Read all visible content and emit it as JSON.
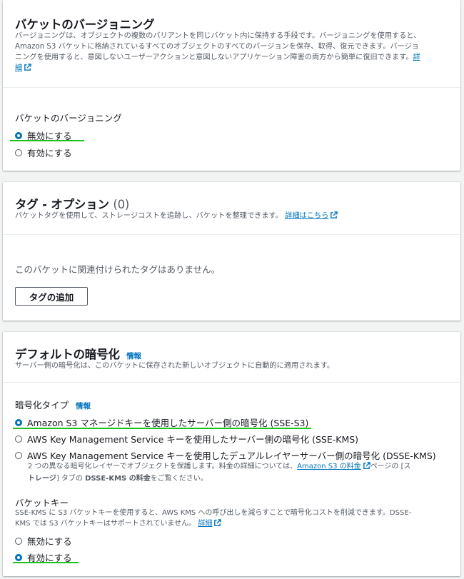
{
  "versioning": {
    "title": "バケットのバージョニング",
    "desc_line1": "バージョニングは、オブジェクトの複数のバリアントを同じバケット内に保持する手段です。バージョニングを使用すると、",
    "desc_line2": "Amazon S3 バケットに格納されているすべてのオブジェクトのすべてのバージョンを保存、取得、復元できます。バージョ",
    "desc_line3": "ニングを使用すると、意図しないユーザーアクションと意図しないアプリケーション障害の両方から簡単に復旧できます。",
    "desc_link_part1": "詳",
    "desc_link_part2": "細",
    "field_label": "バケットのバージョニング",
    "options": [
      "無効にする",
      "有効にする"
    ],
    "selected": "無効にする"
  },
  "tags": {
    "title": "タグ - オプション",
    "count": "(0)",
    "desc": "バケットタグを使用して、ストレージコストを追跡し、バケットを整理できます。",
    "desc_link": "詳細はこちら",
    "empty_text": "このバケットに関連付けられたタグはありません。",
    "add_button": "タグの追加"
  },
  "encryption": {
    "title": "デフォルトの暗号化",
    "info": "情報",
    "desc": "サーバー側の暗号化は、このバケットに保存された新しいオブジェクトに自動的に適用されます。",
    "type_label": "暗号化タイプ",
    "type_info": "情報",
    "options": [
      "Amazon S3 マネージドキーを使用したサーバー側の暗号化 (SSE-S3)",
      "AWS Key Management Service キーを使用したサーバー側の暗号化 (SSE-KMS)",
      "AWS Key Management Service キーを使用したデュアルレイヤーサーバー側の暗号化 (DSSE-KMS)"
    ],
    "selected": "Amazon S3 マネージドキーを使用したサーバー側の暗号化 (SSE-S3)",
    "dsse_desc_line1_a": "2 つの異なる暗号化レイヤーでオブジェクトを保護します。料金の詳細については、",
    "dsse_desc_link": "Amazon S3 の料金",
    "dsse_desc_line1_b": "ページの [ス",
    "dsse_desc_line2_a": "トレージ",
    "dsse_desc_line2_b": "] タブの ",
    "dsse_desc_line2_c": "DSSE-KMS の料金",
    "dsse_desc_line2_d": "をご覧ください。",
    "bucket_key_label": "バケットキー",
    "bucket_key_desc_line1": "SSE-KMS に S3 バケットキーを使用すると、AWS KMS への呼び出しを減らすことで暗号化コストを削減できます。DSSE-",
    "bucket_key_desc_line2": "KMS では S3 バケットキーはサポートされていません。",
    "bucket_key_link": "詳細",
    "bucket_key_options": [
      "無効にする",
      "有効にする"
    ],
    "bucket_key_selected": "有効にする"
  },
  "colors": {
    "link": "#0073bb",
    "radio_selected": "#0073bb",
    "highlight_underline": "#1dc21d",
    "panel_bg": "#ffffff",
    "page_bg": "#f2f3f3"
  }
}
